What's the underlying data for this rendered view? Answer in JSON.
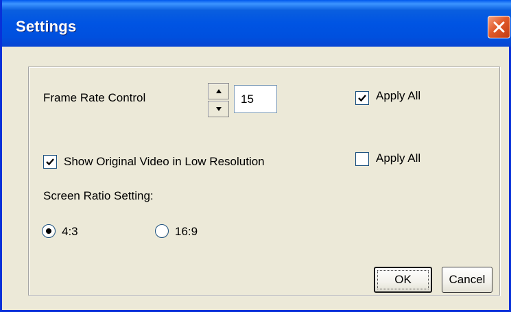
{
  "window": {
    "title": "Settings"
  },
  "frame_rate": {
    "label": "Frame Rate Control",
    "value": "15",
    "apply_all_label": "Apply All",
    "apply_all_checked": true
  },
  "low_res": {
    "label": "Show Original Video in Low Resolution",
    "checked": true,
    "apply_all_label": "Apply All",
    "apply_all_checked": false
  },
  "screen_ratio": {
    "label": "Screen Ratio Setting:",
    "options": [
      {
        "label": "4:3",
        "selected": true
      },
      {
        "label": "16:9",
        "selected": false
      }
    ]
  },
  "buttons": {
    "ok": "OK",
    "cancel": "Cancel"
  },
  "icons": {
    "close": "close-icon",
    "spin_up": "arrow-up-icon",
    "spin_down": "arrow-down-icon",
    "check": "checkmark-icon"
  },
  "colors": {
    "titlebar": "#0054e3",
    "close_button": "#e15a2a",
    "dialog_background": "#ece9d8"
  }
}
